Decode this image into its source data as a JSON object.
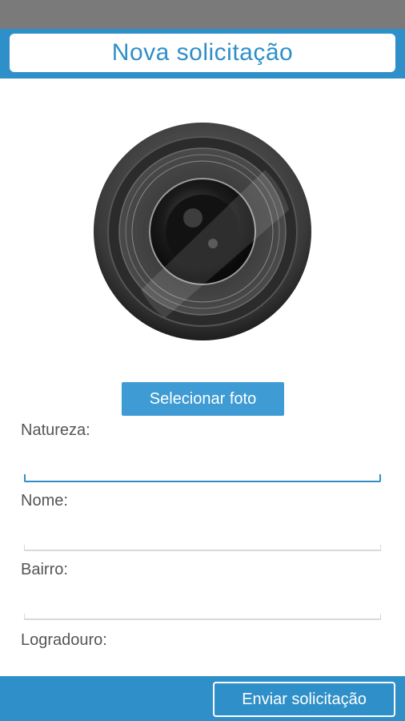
{
  "header": {
    "title": "Nova solicitação"
  },
  "photo": {
    "icon": "camera-lens-icon",
    "select_label": "Selecionar foto"
  },
  "form": {
    "natureza_label": "Natureza:",
    "nome_label": "Nome:",
    "bairro_label": "Bairro:",
    "logradouro_label": "Logradouro:"
  },
  "footer": {
    "submit_label": "Enviar solicitação"
  },
  "colors": {
    "primary": "#2f8fc9",
    "button": "#3e9bd4",
    "statusbar": "#7a7a7a"
  }
}
